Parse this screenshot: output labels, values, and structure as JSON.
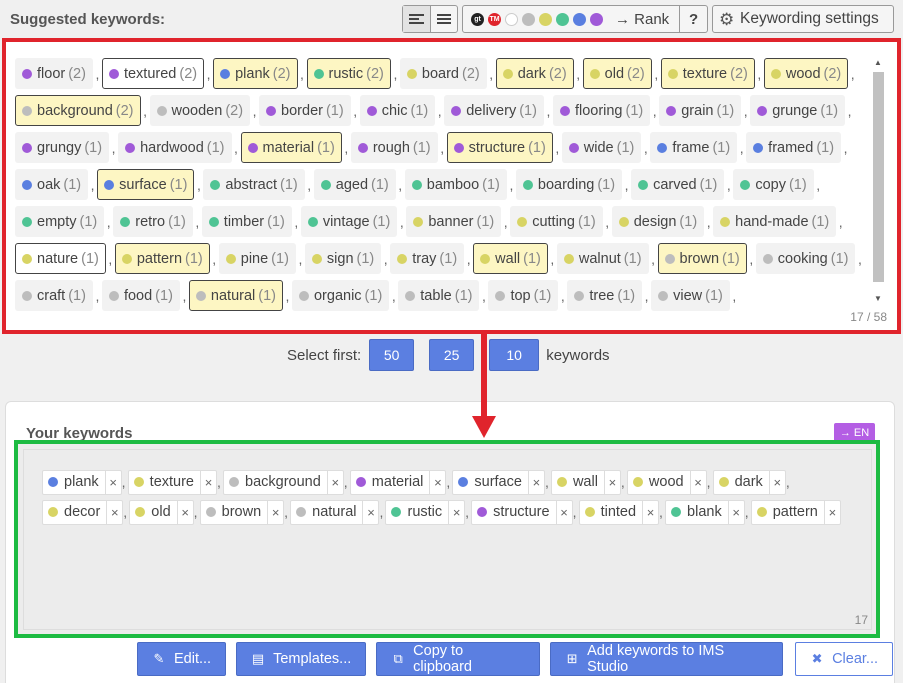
{
  "header": {
    "title": "Suggested keywords:",
    "rank_label": "→ Rank",
    "help_label": "?",
    "settings_label": "Keywording settings",
    "rank_dots": [
      {
        "name": "gt-icon",
        "color": "#222222",
        "text": "gt"
      },
      {
        "name": "tm-icon",
        "color": "#e0242c",
        "text": "TM"
      },
      {
        "name": "color-dot-white",
        "color": "#ffffff",
        "text": ""
      },
      {
        "name": "color-dot-gray",
        "color": "#bdbdbd",
        "text": ""
      },
      {
        "name": "color-dot-yellow",
        "color": "#d8d464",
        "text": ""
      },
      {
        "name": "color-dot-green",
        "color": "#4fc494",
        "text": ""
      },
      {
        "name": "color-dot-blue",
        "color": "#5a7fe0",
        "text": ""
      },
      {
        "name": "color-dot-purple",
        "color": "#a05ad8",
        "text": ""
      }
    ]
  },
  "colors": {
    "purple": "#a05ad8",
    "blue": "#5a7fe0",
    "green": "#4fc494",
    "yellow": "#d8d464",
    "gray": "#bdbdbd"
  },
  "suggested": {
    "counter": "17 / 58",
    "rows": [
      [
        {
          "label": "floor",
          "count": "(2)",
          "color": "purple",
          "style": "plain"
        },
        {
          "label": "textured",
          "count": "(2)",
          "color": "purple",
          "style": "sel"
        },
        {
          "label": "plank",
          "count": "(2)",
          "color": "blue",
          "style": "hl"
        },
        {
          "label": "rustic",
          "count": "(2)",
          "color": "green",
          "style": "hl"
        },
        {
          "label": "board",
          "count": "(2)",
          "color": "yellow",
          "style": "plain"
        },
        {
          "label": "dark",
          "count": "(2)",
          "color": "yellow",
          "style": "hl"
        },
        {
          "label": "old",
          "count": "(2)",
          "color": "yellow",
          "style": "hl"
        },
        {
          "label": "texture",
          "count": "(2)",
          "color": "yellow",
          "style": "hl"
        },
        {
          "label": "wood",
          "count": "(2)",
          "color": "yellow",
          "style": "hl"
        }
      ],
      [
        {
          "label": "background",
          "count": "(2)",
          "color": "gray",
          "style": "hl"
        },
        {
          "label": "wooden",
          "count": "(2)",
          "color": "gray",
          "style": "plain"
        },
        {
          "label": "border",
          "count": "(1)",
          "color": "purple",
          "style": "plain"
        },
        {
          "label": "chic",
          "count": "(1)",
          "color": "purple",
          "style": "plain"
        },
        {
          "label": "delivery",
          "count": "(1)",
          "color": "purple",
          "style": "plain"
        },
        {
          "label": "flooring",
          "count": "(1)",
          "color": "purple",
          "style": "plain"
        },
        {
          "label": "grain",
          "count": "(1)",
          "color": "purple",
          "style": "plain"
        },
        {
          "label": "grunge",
          "count": "(1)",
          "color": "purple",
          "style": "plain"
        }
      ],
      [
        {
          "label": "grungy",
          "count": "(1)",
          "color": "purple",
          "style": "plain"
        },
        {
          "label": "hardwood",
          "count": "(1)",
          "color": "purple",
          "style": "plain"
        },
        {
          "label": "material",
          "count": "(1)",
          "color": "purple",
          "style": "hl"
        },
        {
          "label": "rough",
          "count": "(1)",
          "color": "purple",
          "style": "plain"
        },
        {
          "label": "structure",
          "count": "(1)",
          "color": "purple",
          "style": "hl"
        },
        {
          "label": "wide",
          "count": "(1)",
          "color": "purple",
          "style": "plain"
        },
        {
          "label": "frame",
          "count": "(1)",
          "color": "blue",
          "style": "plain"
        },
        {
          "label": "framed",
          "count": "(1)",
          "color": "blue",
          "style": "plain"
        }
      ],
      [
        {
          "label": "oak",
          "count": "(1)",
          "color": "blue",
          "style": "plain"
        },
        {
          "label": "surface",
          "count": "(1)",
          "color": "blue",
          "style": "hl"
        },
        {
          "label": "abstract",
          "count": "(1)",
          "color": "green",
          "style": "plain"
        },
        {
          "label": "aged",
          "count": "(1)",
          "color": "green",
          "style": "plain"
        },
        {
          "label": "bamboo",
          "count": "(1)",
          "color": "green",
          "style": "plain"
        },
        {
          "label": "boarding",
          "count": "(1)",
          "color": "green",
          "style": "plain"
        },
        {
          "label": "carved",
          "count": "(1)",
          "color": "green",
          "style": "plain"
        },
        {
          "label": "copy",
          "count": "(1)",
          "color": "green",
          "style": "plain"
        }
      ],
      [
        {
          "label": "empty",
          "count": "(1)",
          "color": "green",
          "style": "plain"
        },
        {
          "label": "retro",
          "count": "(1)",
          "color": "green",
          "style": "plain"
        },
        {
          "label": "timber",
          "count": "(1)",
          "color": "green",
          "style": "plain"
        },
        {
          "label": "vintage",
          "count": "(1)",
          "color": "green",
          "style": "plain"
        },
        {
          "label": "banner",
          "count": "(1)",
          "color": "yellow",
          "style": "plain"
        },
        {
          "label": "cutting",
          "count": "(1)",
          "color": "yellow",
          "style": "plain"
        },
        {
          "label": "design",
          "count": "(1)",
          "color": "yellow",
          "style": "plain"
        },
        {
          "label": "hand-made",
          "count": "(1)",
          "color": "yellow",
          "style": "plain"
        }
      ],
      [
        {
          "label": "nature",
          "count": "(1)",
          "color": "yellow",
          "style": "sel"
        },
        {
          "label": "pattern",
          "count": "(1)",
          "color": "yellow",
          "style": "hl"
        },
        {
          "label": "pine",
          "count": "(1)",
          "color": "yellow",
          "style": "plain"
        },
        {
          "label": "sign",
          "count": "(1)",
          "color": "yellow",
          "style": "plain"
        },
        {
          "label": "tray",
          "count": "(1)",
          "color": "yellow",
          "style": "plain"
        },
        {
          "label": "wall",
          "count": "(1)",
          "color": "yellow",
          "style": "hl"
        },
        {
          "label": "walnut",
          "count": "(1)",
          "color": "yellow",
          "style": "plain"
        },
        {
          "label": "brown",
          "count": "(1)",
          "color": "gray",
          "style": "hl"
        },
        {
          "label": "cooking",
          "count": "(1)",
          "color": "gray",
          "style": "plain"
        }
      ],
      [
        {
          "label": "craft",
          "count": "(1)",
          "color": "gray",
          "style": "plain"
        },
        {
          "label": "food",
          "count": "(1)",
          "color": "gray",
          "style": "plain"
        },
        {
          "label": "natural",
          "count": "(1)",
          "color": "gray",
          "style": "hl"
        },
        {
          "label": "organic",
          "count": "(1)",
          "color": "gray",
          "style": "plain"
        },
        {
          "label": "table",
          "count": "(1)",
          "color": "gray",
          "style": "plain"
        },
        {
          "label": "top",
          "count": "(1)",
          "color": "gray",
          "style": "plain"
        },
        {
          "label": "tree",
          "count": "(1)",
          "color": "gray",
          "style": "plain"
        },
        {
          "label": "view",
          "count": "(1)",
          "color": "gray",
          "style": "plain"
        }
      ]
    ]
  },
  "select_first": {
    "label": "Select first:",
    "options": [
      "50",
      "25",
      "10"
    ],
    "suffix": "keywords"
  },
  "your_keywords": {
    "title": "Your keywords",
    "lang_label": "→ EN",
    "counter": "17",
    "remove_glyph": "×",
    "rows": [
      [
        {
          "label": "plank",
          "color": "blue"
        },
        {
          "label": "texture",
          "color": "yellow"
        },
        {
          "label": "background",
          "color": "gray"
        },
        {
          "label": "material",
          "color": "purple"
        },
        {
          "label": "surface",
          "color": "blue"
        },
        {
          "label": "wall",
          "color": "yellow"
        },
        {
          "label": "wood",
          "color": "yellow"
        },
        {
          "label": "dark",
          "color": "yellow"
        }
      ],
      [
        {
          "label": "decor",
          "color": "yellow"
        },
        {
          "label": "old",
          "color": "yellow"
        },
        {
          "label": "brown",
          "color": "gray"
        },
        {
          "label": "natural",
          "color": "gray"
        },
        {
          "label": "rustic",
          "color": "green"
        },
        {
          "label": "structure",
          "color": "purple"
        },
        {
          "label": "tinted",
          "color": "yellow"
        },
        {
          "label": "blank",
          "color": "green"
        },
        {
          "label": "pattern",
          "color": "yellow"
        }
      ]
    ]
  },
  "actions": {
    "edit": "Edit...",
    "templates": "Templates...",
    "copy": "Copy to clipboard",
    "add": "Add keywords to IMS Studio",
    "clear": "Clear..."
  }
}
